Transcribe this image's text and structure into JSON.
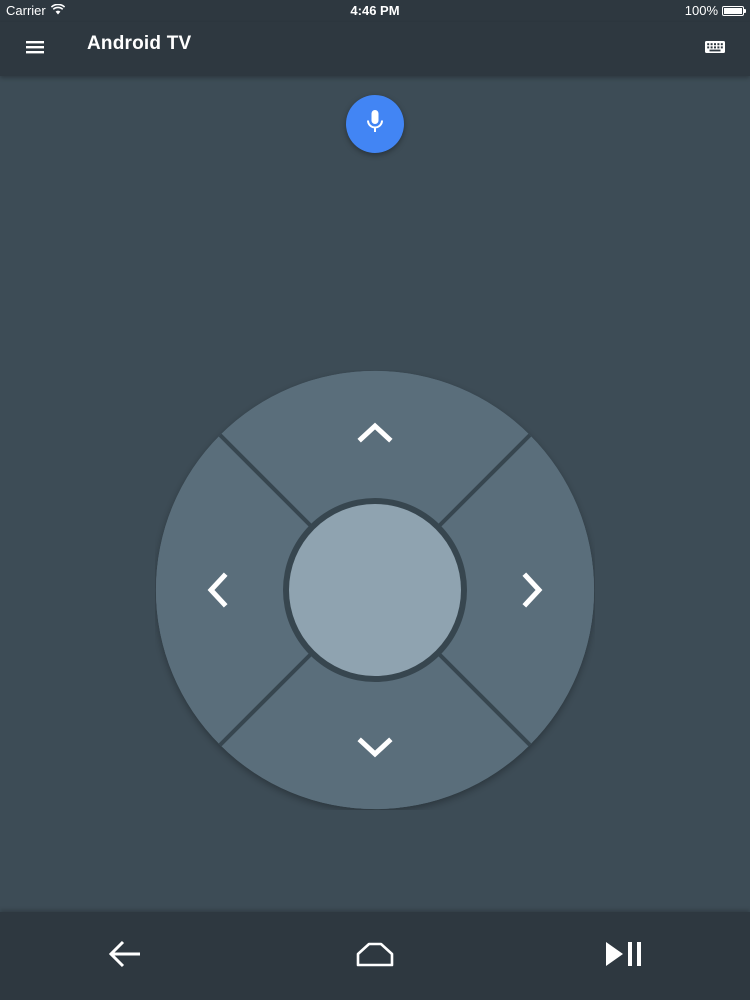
{
  "status_bar": {
    "carrier": "Carrier",
    "time": "4:46 PM",
    "battery": "100%",
    "battery_level": 1.0
  },
  "app_bar": {
    "title": "Android TV",
    "menu_icon": "hamburger-menu-icon",
    "keyboard_icon": "keyboard-icon"
  },
  "voice": {
    "icon": "microphone-icon",
    "color": "#4285f4"
  },
  "dpad": {
    "up_icon": "chevron-up-icon",
    "down_icon": "chevron-down-icon",
    "left_icon": "chevron-left-icon",
    "right_icon": "chevron-right-icon",
    "ring_color": "#5a6e7b",
    "center_color": "#8fa3b0"
  },
  "bottom_bar": {
    "back_icon": "arrow-back-icon",
    "home_icon": "home-icon",
    "play_pause_icon": "play-pause-icon"
  },
  "colors": {
    "background": "#3d4c56",
    "bars": "#2e3840",
    "icon": "#ffffff"
  }
}
